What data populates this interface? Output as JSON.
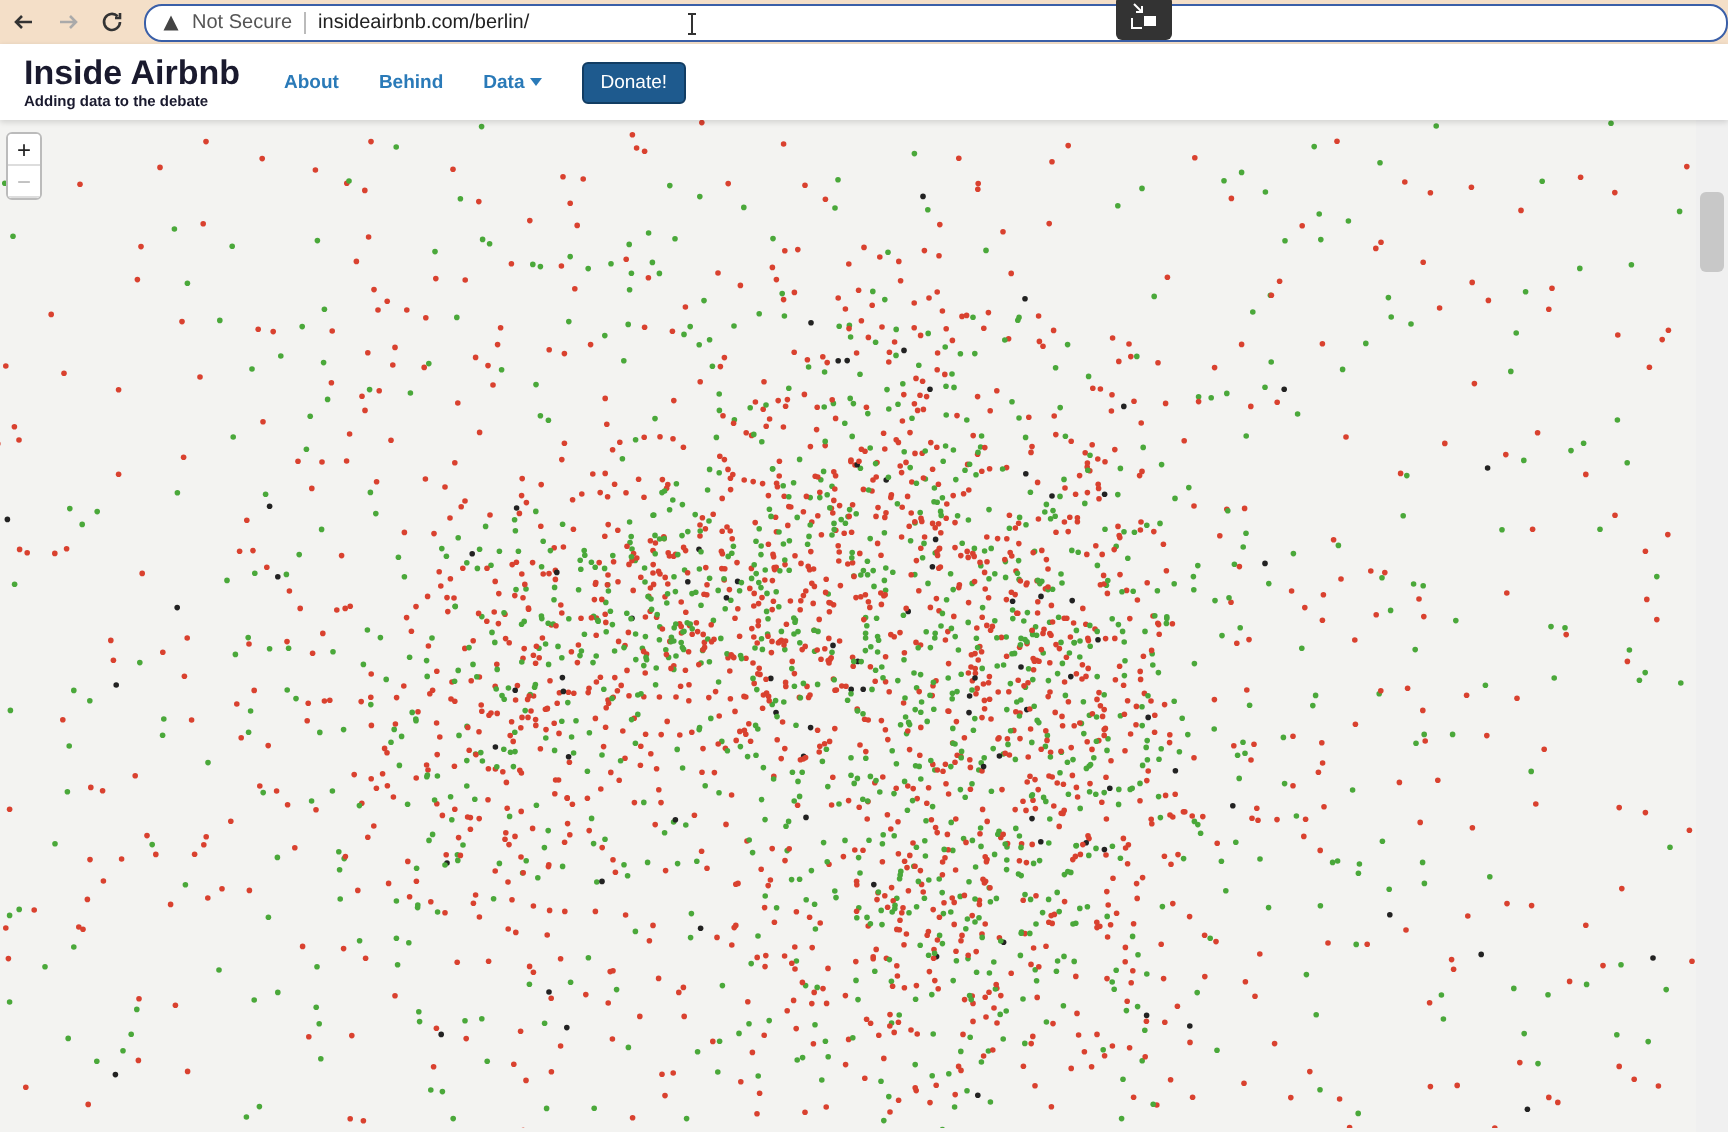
{
  "browser": {
    "security_label": "Not Secure",
    "url": "insideairbnb.com/berlin/"
  },
  "site": {
    "title": "Inside Airbnb",
    "tagline": "Adding data to the debate"
  },
  "nav": [
    {
      "label": "About",
      "kind": "link"
    },
    {
      "label": "Behind",
      "kind": "link"
    },
    {
      "label": "Data",
      "kind": "dropdown"
    },
    {
      "label": "Donate!",
      "kind": "button"
    }
  ],
  "map_controls": [
    {
      "label": "+",
      "disabled": false
    },
    {
      "label": "−",
      "disabled": true
    }
  ]
}
